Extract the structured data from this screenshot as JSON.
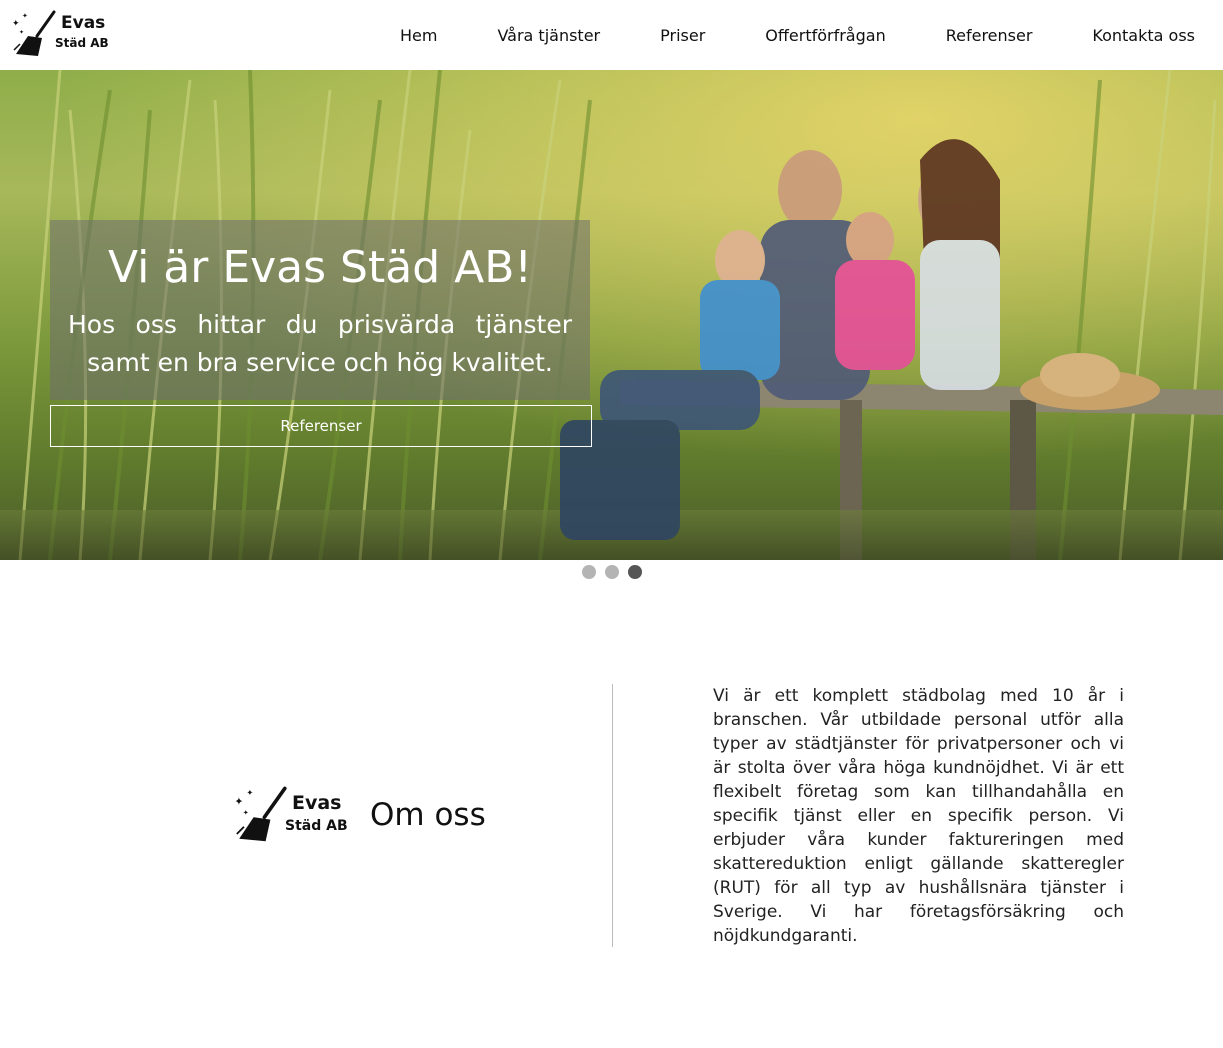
{
  "brand": {
    "line1": "Evas",
    "line2": "Städ AB"
  },
  "nav": {
    "items": [
      {
        "label": "Hem"
      },
      {
        "label": "Våra tjänster"
      },
      {
        "label": "Priser"
      },
      {
        "label": "Offertförfrågan"
      },
      {
        "label": "Referenser"
      },
      {
        "label": "Kontakta oss"
      }
    ]
  },
  "hero": {
    "title": "Vi är Evas Städ AB!",
    "subtitle": "Hos oss hittar du prisvärda tjänster samt en bra service och hög kvalitet.",
    "button_label": "Referenser",
    "slides_total": 3,
    "active_slide": 3
  },
  "about": {
    "title": "Om oss",
    "body": "Vi är ett komplett städbolag med 10 år i branschen. Vår utbildade personal utför alla typer av städtjänster för privatpersoner och vi är stolta över våra höga kundnöjdhet. Vi är ett flexibelt företag som kan tillhandahålla en specifik tjänst eller en specifik person. Vi erbjuder våra kunder faktureringen med skattereduktion enligt gällande skatteregler (RUT) för all typ av hushållsnära tjänster i Sverige. Vi har företagsförsäkring och nöjdkundgaranti."
  },
  "icons": {
    "logo": "broom-icon"
  }
}
